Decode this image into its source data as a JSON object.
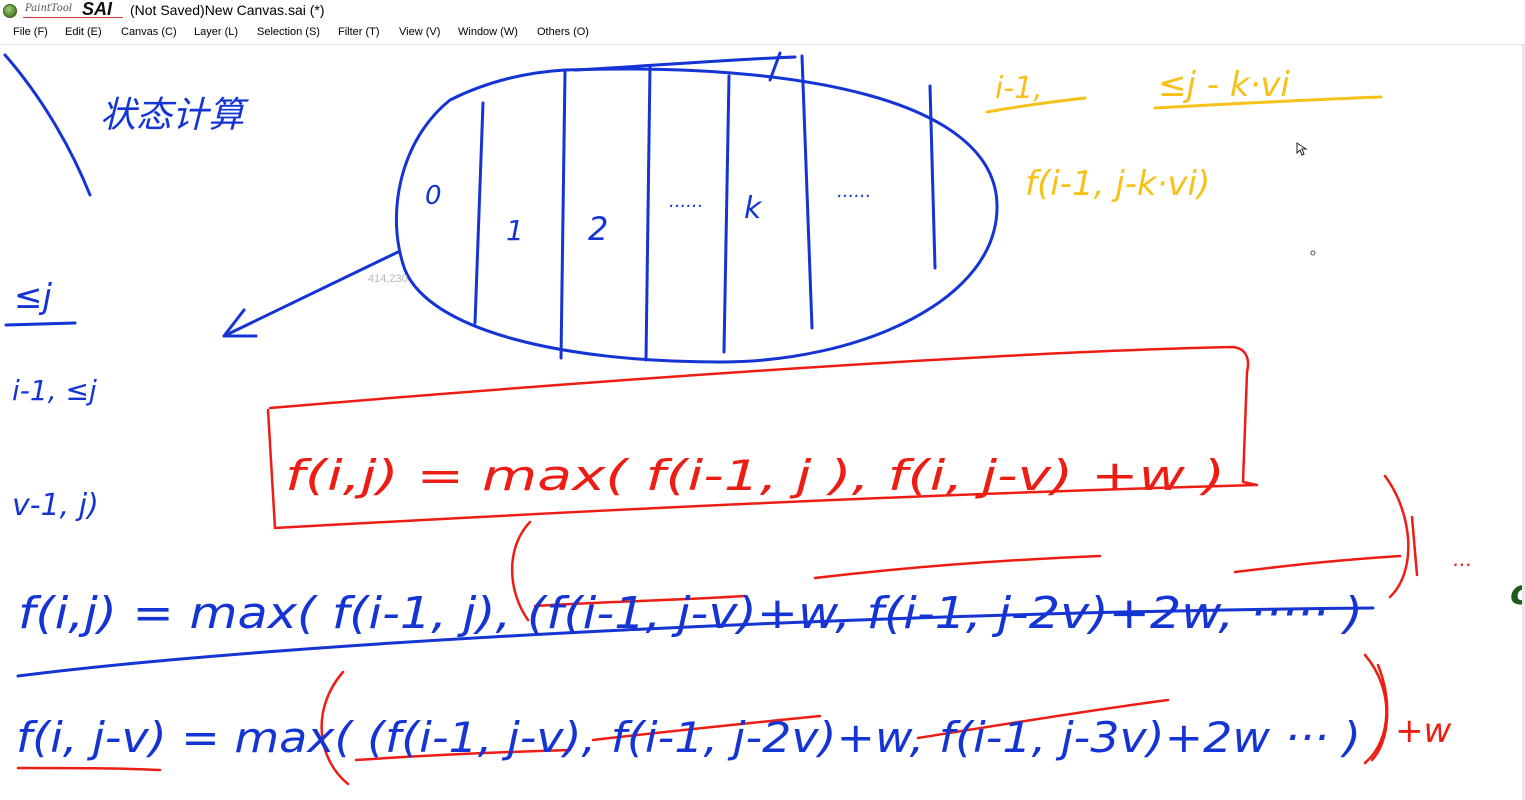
{
  "app": {
    "logo_small_text": "PaintTool",
    "logo_big_text": "SAI",
    "window_title": "(Not Saved)New Canvas.sai (*)"
  },
  "menu": [
    {
      "label": "File (F)"
    },
    {
      "label": "Edit (E)"
    },
    {
      "label": "Canvas (C)"
    },
    {
      "label": "Layer (L)"
    },
    {
      "label": "Selection (S)"
    },
    {
      "label": "Filter (T)"
    },
    {
      "label": "View (V)"
    },
    {
      "label": "Window (W)"
    },
    {
      "label": "Others (O)"
    }
  ],
  "canvas": {
    "position_readout": "414,230",
    "handwriting": {
      "title_zh": "状态计算",
      "sub_zh": "≤j",
      "items": [
        "i-1, ≤j",
        "v-1, j)"
      ],
      "ellipse_labels": [
        "0",
        "1",
        "2",
        "······",
        "k",
        "······"
      ],
      "yellow_top_left": "i-1,",
      "yellow_top_right": "≤j - k·vi",
      "yellow_formula": "f(i-1, j-k·vi)",
      "red_box_formula": "f(i,j) = max( f(i-1, j ),   f(i, j-v)  +w )",
      "line1": "f(i,j) = max( f(i-1, j),  (f(i-1, j-v)+w,  f(i-1, j-2v)+2w, ····· )",
      "line1_tail": "···",
      "line2": "f(i, j-v) = max( (f(i-1, j-v),  f(i-1, j-2v)+w,  f(i-1, j-3v)+2w ··· )",
      "line2_tail": "+w",
      "edge_glyph": "c"
    }
  },
  "colors": {
    "blue_ink": "#1434d4",
    "red_ink": "#ee1d14",
    "yellow_ink": "#f6c21a"
  },
  "icons": {
    "cursor": "arrow-cursor-icon",
    "logo": "painttool-sai-logo"
  }
}
